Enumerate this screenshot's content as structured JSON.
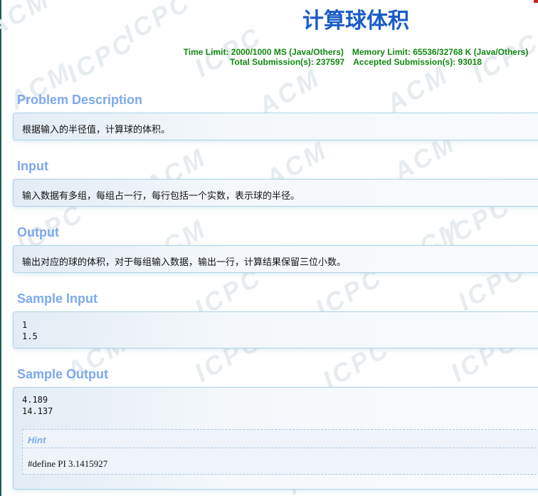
{
  "problem": {
    "title": "计算球体积",
    "limits": {
      "time_limit": "Time Limit: 2000/1000 MS (Java/Others)",
      "memory_limit": "Memory Limit: 65536/32768 K (Java/Others)",
      "total_submissions": "Total Submission(s): 237597",
      "accepted_submissions": "Accepted Submission(s): 93018"
    },
    "sections": {
      "description": {
        "title": "Problem Description",
        "text": "根据输入的半径值，计算球的体积。"
      },
      "input": {
        "title": "Input",
        "text": "输入数据有多组，每组占一行，每行包括一个实数，表示球的半径。"
      },
      "output": {
        "title": "Output",
        "text": "输出对应的球的体积，对于每组输入数据，输出一行，计算结果保留三位小数。"
      },
      "sample_input": {
        "title": "Sample Input",
        "text": "1\n1.5"
      },
      "sample_output": {
        "title": "Sample Output",
        "text": "4.189\n14.137"
      },
      "hint": {
        "label": "Hint",
        "text": "#define PI 3.1415927"
      }
    },
    "watermark_text": "ACM ICPC",
    "colors": {
      "title": "#1a5cc8",
      "limits": "#118811",
      "section_title": "#7ca9ed",
      "panel_border": "#aad4ea"
    }
  }
}
